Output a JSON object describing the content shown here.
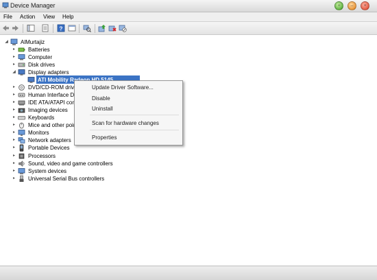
{
  "window": {
    "title": "Device Manager",
    "icon": "device-manager-icon",
    "controls": [
      "maximize",
      "minimize",
      "close"
    ]
  },
  "menubar": {
    "items": [
      "File",
      "Action",
      "View",
      "Help"
    ]
  },
  "toolbar": {
    "buttons": [
      "back-icon",
      "forward-icon",
      "show-hide-tree-icon",
      "properties-icon",
      "help-icon",
      "view-icon",
      "scan-hardware-icon",
      "update-driver-icon",
      "uninstall-icon",
      "disable-icon"
    ]
  },
  "tree": {
    "root": "AlMurtajiz",
    "items": [
      {
        "label": "Batteries",
        "icon": "battery-icon",
        "state": "collapsed"
      },
      {
        "label": "Computer",
        "icon": "computer-icon",
        "state": "collapsed"
      },
      {
        "label": "Disk drives",
        "icon": "disk-drive-icon",
        "state": "collapsed"
      },
      {
        "label": "Display adapters",
        "icon": "display-adapter-icon",
        "state": "expanded"
      },
      {
        "label": "ATI Mobility Radeon HD 5145",
        "icon": "display-adapter-icon",
        "state": "child-selected"
      },
      {
        "label": "DVD/CD-ROM drives",
        "icon": "dvd-drive-icon",
        "state": "collapsed"
      },
      {
        "label": "Human Interface Devices",
        "icon": "hid-icon",
        "state": "collapsed"
      },
      {
        "label": "IDE ATA/ATAPI controllers",
        "icon": "ide-controller-icon",
        "state": "collapsed"
      },
      {
        "label": "Imaging devices",
        "icon": "camera-icon",
        "state": "collapsed"
      },
      {
        "label": "Keyboards",
        "icon": "keyboard-icon",
        "state": "collapsed"
      },
      {
        "label": "Mice and other pointing devices",
        "icon": "mouse-icon",
        "state": "collapsed"
      },
      {
        "label": "Monitors",
        "icon": "monitor-icon",
        "state": "collapsed"
      },
      {
        "label": "Network adapters",
        "icon": "network-adapter-icon",
        "state": "collapsed"
      },
      {
        "label": "Portable Devices",
        "icon": "portable-device-icon",
        "state": "collapsed"
      },
      {
        "label": "Processors",
        "icon": "processor-icon",
        "state": "collapsed"
      },
      {
        "label": "Sound, video and game controllers",
        "icon": "sound-icon",
        "state": "collapsed"
      },
      {
        "label": "System devices",
        "icon": "system-device-icon",
        "state": "collapsed"
      },
      {
        "label": "Universal Serial Bus controllers",
        "icon": "usb-icon",
        "state": "collapsed"
      }
    ]
  },
  "context_menu": {
    "items": [
      "Update Driver Software...",
      "Disable",
      "Uninstall",
      "Scan for hardware changes",
      "Properties"
    ]
  },
  "colors": {
    "selection": "#3b73c4",
    "menu_bg": "#f6f6f6"
  }
}
